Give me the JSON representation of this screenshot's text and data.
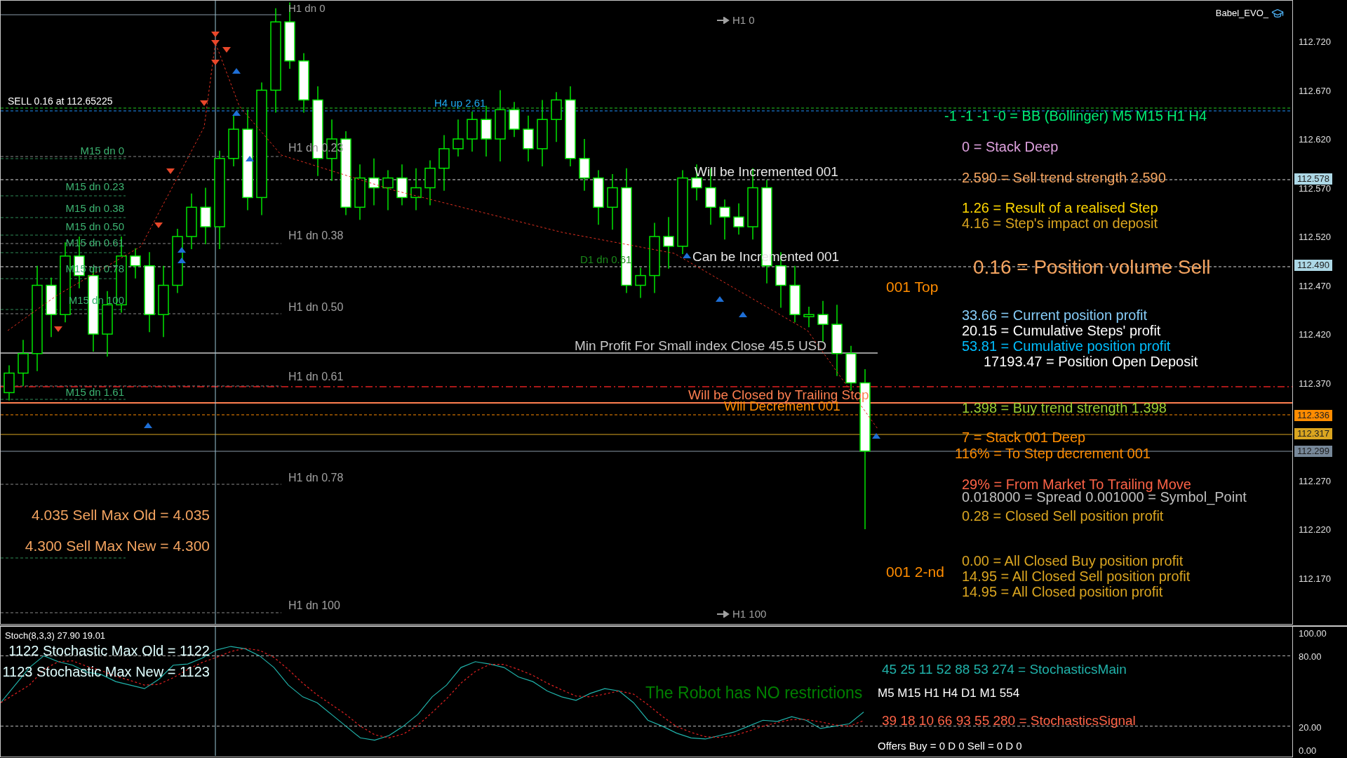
{
  "expert": {
    "name": "Babel_EVO_"
  },
  "chart": {
    "labels": [
      {
        "text": "H1 dn 0",
        "color": "#a0a0a0",
        "kind": "text"
      },
      {
        "text": "H1 0",
        "color": "#a0a0a0",
        "kind": "arrow"
      },
      {
        "text": "SELL 0.16 at 112.65225",
        "color": "#ffffff",
        "kind": "text"
      },
      {
        "text": "H4 up 2.61",
        "color": "#1eaaf0",
        "kind": "text"
      },
      {
        "text": "M15 dn 0",
        "color": "#3cb371",
        "kind": "text"
      },
      {
        "text": "H1 dn 0.23",
        "color": "#a0a0a0",
        "kind": "text"
      },
      {
        "text": "M15 dn 0.23",
        "color": "#3cb371",
        "kind": "text"
      },
      {
        "text": "M15 dn 0.38",
        "color": "#3cb371",
        "kind": "text"
      },
      {
        "text": "M15 dn 0.50",
        "color": "#3cb371",
        "kind": "text"
      },
      {
        "text": "M15 dn 0.61",
        "color": "#3cb371",
        "kind": "text"
      },
      {
        "text": "M15 dn 0.78",
        "color": "#3cb371",
        "kind": "text"
      },
      {
        "text": "M15 dn 100",
        "color": "#3cb371",
        "kind": "text"
      },
      {
        "text": "H1 dn 0.38",
        "color": "#a0a0a0",
        "kind": "text"
      },
      {
        "text": "D1 dn 0.61",
        "color": "#1a8a1a",
        "kind": "text"
      },
      {
        "text": "Will be Incremented 001",
        "color": "#e6e6e6",
        "kind": "text"
      },
      {
        "text": "Can be Incremented 001",
        "color": "#e6e6e6",
        "kind": "text"
      },
      {
        "text": "H1 dn 0.50",
        "color": "#a0a0a0",
        "kind": "text"
      },
      {
        "text": "Min Profit For Small index Close  45.5 USD",
        "color": "#c8c8c8",
        "kind": "text"
      },
      {
        "text": "H1 dn 0.61",
        "color": "#a0a0a0",
        "kind": "text"
      },
      {
        "text": "M15 dn 1.61",
        "color": "#3cb371",
        "kind": "text"
      },
      {
        "text": "Will be Closed by Trailing Stop",
        "color": "#ff7f50",
        "kind": "text"
      },
      {
        "text": "Will Decrement 001",
        "color": "#ff8c00",
        "kind": "text"
      },
      {
        "text": "H1 dn 0.78",
        "color": "#a0a0a0",
        "kind": "text"
      },
      {
        "text": "H1 dn 100",
        "color": "#a0a0a0",
        "kind": "text"
      },
      {
        "text": "H1 100",
        "color": "#a0a0a0",
        "kind": "arrow"
      },
      {
        "text": "001 Top",
        "color": "#ff8c00",
        "kind": "text"
      },
      {
        "text": "001 2-nd",
        "color": "#ff8c00",
        "kind": "text"
      },
      {
        "text": "4.035 Sell Max Old = 4.035",
        "color": "#f4a460",
        "kind": "text"
      },
      {
        "text": "4.300 Sell Max New = 4.300",
        "color": "#f4a460",
        "kind": "text"
      }
    ],
    "info_panel": [
      {
        "text": "-1 -1 -1 -0 = BB (Bollinger) M5 M15 H1 H4",
        "color": "#00ee76"
      },
      {
        "text": "0 =  Stack Deep",
        "color": "#dda0dd"
      },
      {
        "text": "2.590 = Sell trend strength 2.590",
        "color": "#f4a460"
      },
      {
        "text": "1.26 = Result of a realised Step",
        "color": "#ffd700"
      },
      {
        "text": "4.16 = Step's impact on deposit",
        "color": "#daa520"
      },
      {
        "text": "0.16 = Position volume Sell",
        "color": "#f4a460"
      },
      {
        "text": "33.66 = Current position profit",
        "color": "#87cefa"
      },
      {
        "text": "20.15 = Cumulative Steps' profit",
        "color": "#ffffff"
      },
      {
        "text": "53.81 = Cumulative position profit",
        "color": "#00bfff"
      },
      {
        "text": "17193.47 = Position Open Deposit",
        "color": "#ffffff"
      },
      {
        "text": "1.398 = Buy trend strength 1.398",
        "color": "#9acd32"
      },
      {
        "text": "7 =  Stack 001 Deep",
        "color": "#ff8c00"
      },
      {
        "text": "116% =  To Step decrement 001",
        "color": "#ff8c00"
      },
      {
        "text": "29% =  From Market To Trailing Move",
        "color": "#ff6347"
      },
      {
        "text": "0.018000 = Spread   0.001000 = Symbol_Point",
        "color": "#c0c0c0"
      },
      {
        "text": "0.28 = Closed Sell position profit",
        "color": "#daa520"
      },
      {
        "text": "0.00 =  All Closed Buy position profit",
        "color": "#daa520"
      },
      {
        "text": "14.95 =  All Closed Sell position profit",
        "color": "#daa520"
      },
      {
        "text": "14.95 =  All Closed position profit",
        "color": "#daa520"
      }
    ],
    "price_axis": {
      "ticks": [
        "112.720",
        "112.670",
        "112.620",
        "112.570",
        "112.520",
        "112.470",
        "112.420",
        "112.370",
        "112.270",
        "112.220",
        "112.170"
      ],
      "tags": [
        {
          "text": "112.578",
          "color": "#add8e6"
        },
        {
          "text": "112.490",
          "color": "#add8e6"
        },
        {
          "text": "112.336",
          "color": "#ff8c00"
        },
        {
          "text": "112.317",
          "color": "#daa520"
        },
        {
          "text": "112.299",
          "color": "#778899"
        }
      ]
    }
  },
  "indicator": {
    "title": "Stoch(8,3,3) 27.90 19.01",
    "labels": [
      {
        "text": "1122 Stochastic Max Old = 1122",
        "color": "#e0ffff"
      },
      {
        "text": "1123 Stochastic Max New = 1123",
        "color": "#e0ffff"
      },
      {
        "text": "45  25  11  52  88  53  274 = StochasticsMain",
        "color": "#20b2aa"
      },
      {
        "text": "The Robot has NO restrictions",
        "color": "#008000"
      },
      {
        "text": "M5  M15 H1  H4  D1  M1  554",
        "color": "#ffffff"
      },
      {
        "text": "39  18  10  66  93  55  280 = StochasticsSignal",
        "color": "#ff6347"
      },
      {
        "text": "Offers Buy = 0 D 0  Sell = 0 D 0",
        "color": "#ffffff"
      }
    ],
    "axis_ticks": [
      "100.00",
      "80.00",
      "20.00",
      "0.00"
    ]
  }
}
